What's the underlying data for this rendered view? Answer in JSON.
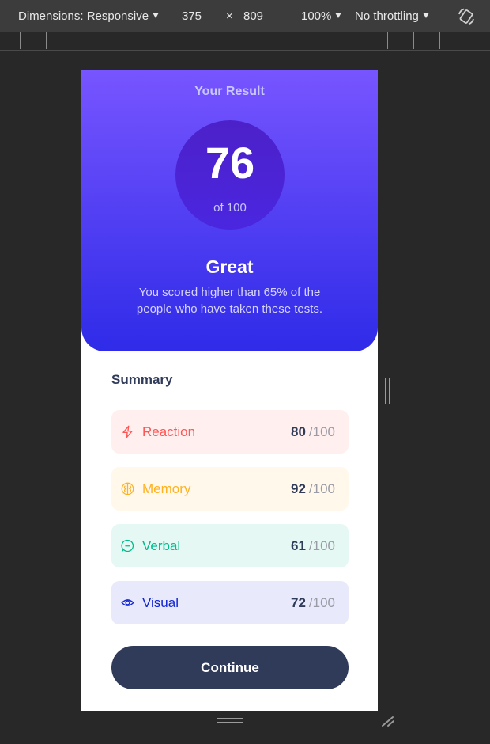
{
  "toolbar": {
    "dimensions_label": "Dimensions: Responsive",
    "width": "375",
    "times": "×",
    "height": "809",
    "zoom": "100%",
    "throttling": "No throttling",
    "rotate_icon": "rotate-icon"
  },
  "result": {
    "title": "Your Result",
    "score": "76",
    "score_of": "of 100",
    "grade": "Great",
    "description": "You scored higher than 65% of the people who have taken these tests."
  },
  "summary": {
    "title": "Summary",
    "items": [
      {
        "label": "Reaction",
        "score": "80",
        "max": "/100",
        "icon": "lightning-icon",
        "color": "#ff5555",
        "bg": "#fff0ef"
      },
      {
        "label": "Memory",
        "score": "92",
        "max": "/100",
        "icon": "brain-icon",
        "color": "#ffb11f",
        "bg": "#fff8eb"
      },
      {
        "label": "Verbal",
        "score": "61",
        "max": "/100",
        "icon": "chat-icon",
        "color": "#00bb8f",
        "bg": "#e6f8f3"
      },
      {
        "label": "Visual",
        "score": "72",
        "max": "/100",
        "icon": "eye-icon",
        "color": "#1125d4",
        "bg": "#e8e9fa"
      }
    ],
    "continue_label": "Continue"
  }
}
